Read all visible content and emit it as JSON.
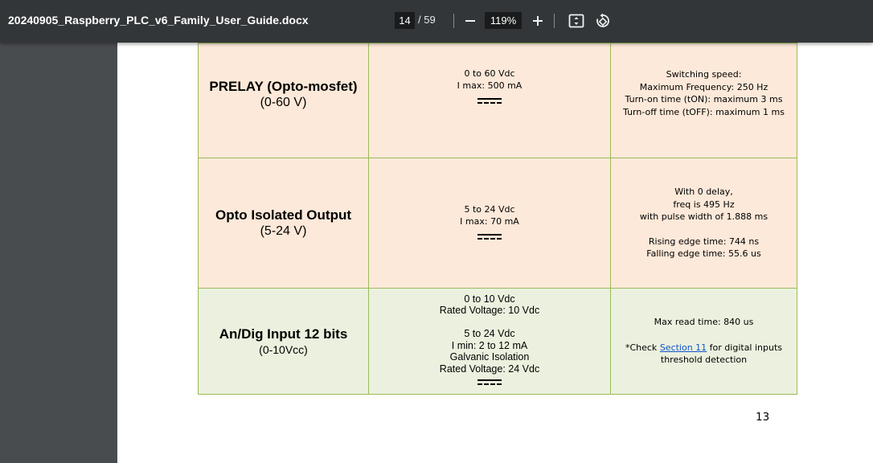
{
  "toolbar": {
    "title": "20240905_Raspberry_PLC_v6_Family_User_Guide.docx",
    "current_page": "14",
    "page_total": "/ 59",
    "zoom": "119%",
    "icons": [
      "zoom-out-icon",
      "zoom-in-icon",
      "fit-page-icon",
      "rotate-icon"
    ]
  },
  "table": {
    "rows": [
      {
        "name": "PRELAY (Opto-mosfet)",
        "range": "(0-60 V)",
        "specs": [
          "0 to 60 Vdc",
          "I max: 500 mA"
        ],
        "notes": [
          "Switching speed:",
          "Maximum Frequency: 250 Hz",
          "Turn-on time (tON): maximum 3 ms",
          "Turn-off time (tOFF): maximum 1 ms"
        ]
      },
      {
        "name": "Opto Isolated Output",
        "range": "(5-24 V)",
        "specs": [
          "5 to 24  Vdc",
          "I max: 70 mA"
        ],
        "notes": [
          "With 0 delay,",
          "freq is 495 Hz",
          "with pulse width of 1.888 ms",
          "",
          "Rising edge time: 744 ns",
          "Falling edge time: 55.6 us"
        ]
      },
      {
        "name": "An/Dig Input 12 bits",
        "range": "(0-10Vcc)",
        "specs": [
          "0 to 10 Vdc",
          "Rated Voltage: 10 Vdc",
          "",
          "5 to 24 Vdc",
          "I min: 2 to 12 mA",
          "Galvanic Isolation",
          "Rated Voltage: 24 Vdc"
        ],
        "notes_read": "Max read time: 840 us",
        "notes_check_prefix": "*Check ",
        "notes_check_link": "Section 11",
        "notes_check_suffix": " for digital inputs",
        "notes_check_line2": "threshold detection"
      }
    ]
  },
  "page_number": "13",
  "colors": {
    "toolbar": "#323639",
    "background": "#525659",
    "row_orange": "#fde9d9",
    "row_green": "#ebf1de",
    "border": "#9bbb59",
    "link": "#1155cc"
  }
}
